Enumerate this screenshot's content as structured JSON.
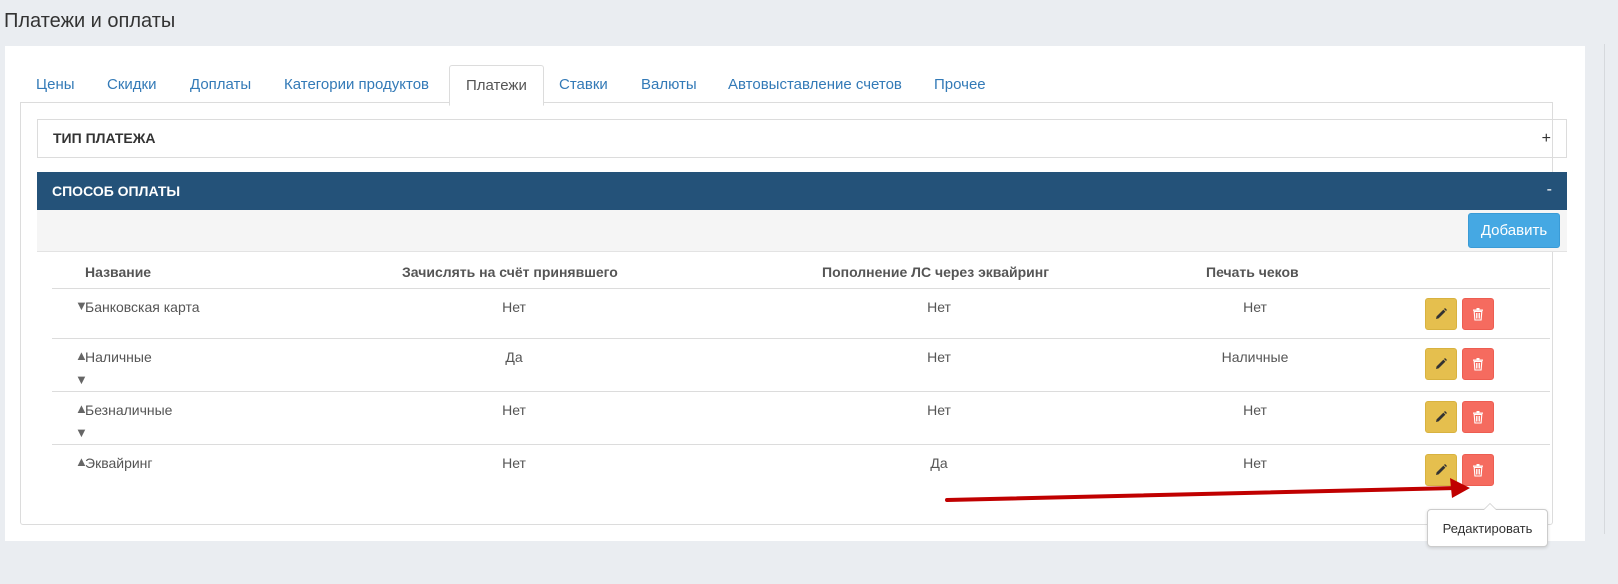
{
  "page": {
    "title": "Платежи и оплаты"
  },
  "tabs": [
    {
      "label": "Цены"
    },
    {
      "label": "Скидки"
    },
    {
      "label": "Доплаты"
    },
    {
      "label": "Категории продуктов"
    },
    {
      "label": "Платежи",
      "active": true
    },
    {
      "label": "Ставки"
    },
    {
      "label": "Валюты"
    },
    {
      "label": "Автовыставление счетов"
    },
    {
      "label": "Прочее"
    }
  ],
  "panel_payment_type": {
    "title": "ТИП ПЛАТЕЖА",
    "toggle": "+"
  },
  "panel_payment_method": {
    "title": "СПОСОБ ОПЛАТЫ",
    "toggle": "-"
  },
  "toolbar": {
    "add_label": "Добавить"
  },
  "table": {
    "headers": {
      "name": "Название",
      "credit": "Зачислять на счёт принявшего",
      "acquiring": "Пополнение ЛС через эквайринг",
      "print": "Печать чеков"
    },
    "rows": [
      {
        "name": "Банковская карта",
        "credit": "Нет",
        "acquiring": "Нет",
        "print": "Нет",
        "up": false,
        "down": true
      },
      {
        "name": "Наличные",
        "credit": "Да",
        "acquiring": "Нет",
        "print": "Наличные",
        "up": true,
        "down": true
      },
      {
        "name": "Безналичные",
        "credit": "Нет",
        "acquiring": "Нет",
        "print": "Нет",
        "up": true,
        "down": true
      },
      {
        "name": "Эквайринг",
        "credit": "Нет",
        "acquiring": "Да",
        "print": "Нет",
        "up": true,
        "down": false
      }
    ]
  },
  "tooltip": {
    "text": "Редактировать"
  },
  "colors": {
    "accent": "#245279",
    "link": "#337ab7",
    "add_button": "#45a8e3",
    "edit_button": "#e5bf4e",
    "delete_button": "#f56b5f",
    "annotation_arrow": "#c00000"
  },
  "icons": {
    "edit": "pencil-icon",
    "delete": "trash-icon",
    "move_up": "triangle-up-icon",
    "move_down": "triangle-down-icon"
  }
}
